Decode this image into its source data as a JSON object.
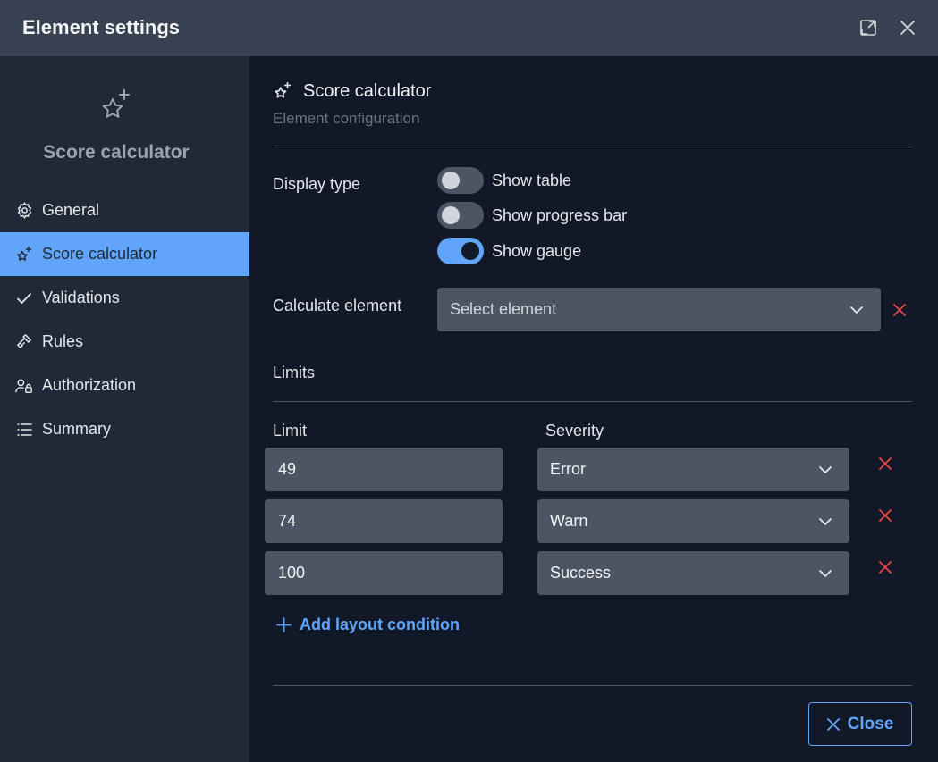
{
  "window": {
    "title": "Element settings"
  },
  "sidebar": {
    "hero_title": "Score calculator",
    "items": [
      {
        "label": "General",
        "icon": "gear-icon"
      },
      {
        "label": "Score calculator",
        "icon": "sparkle-star-icon",
        "active": true
      },
      {
        "label": "Validations",
        "icon": "checkmark-icon"
      },
      {
        "label": "Rules",
        "icon": "gavel-icon"
      },
      {
        "label": "Authorization",
        "icon": "user-lock-icon"
      },
      {
        "label": "Summary",
        "icon": "list-icon"
      }
    ]
  },
  "main": {
    "title": "Score calculator",
    "subtitle": "Element configuration",
    "display_type": {
      "label": "Display type",
      "options": [
        {
          "label": "Show table",
          "on": false
        },
        {
          "label": "Show progress bar",
          "on": false
        },
        {
          "label": "Show gauge",
          "on": true
        }
      ]
    },
    "calculate_element": {
      "label": "Calculate element",
      "placeholder": "Select element"
    },
    "limits": {
      "title": "Limits",
      "limit_header": "Limit",
      "severity_header": "Severity",
      "rows": [
        {
          "limit": "49",
          "severity": "Error"
        },
        {
          "limit": "74",
          "severity": "Warn"
        },
        {
          "limit": "100",
          "severity": "Success"
        }
      ],
      "add_label": "Add layout condition"
    },
    "close_label": "Close"
  },
  "colors": {
    "accent": "#60a5fa",
    "danger": "#ef4444",
    "titlebar": "#374151",
    "sidebar": "#1f2937",
    "main": "#111827"
  }
}
